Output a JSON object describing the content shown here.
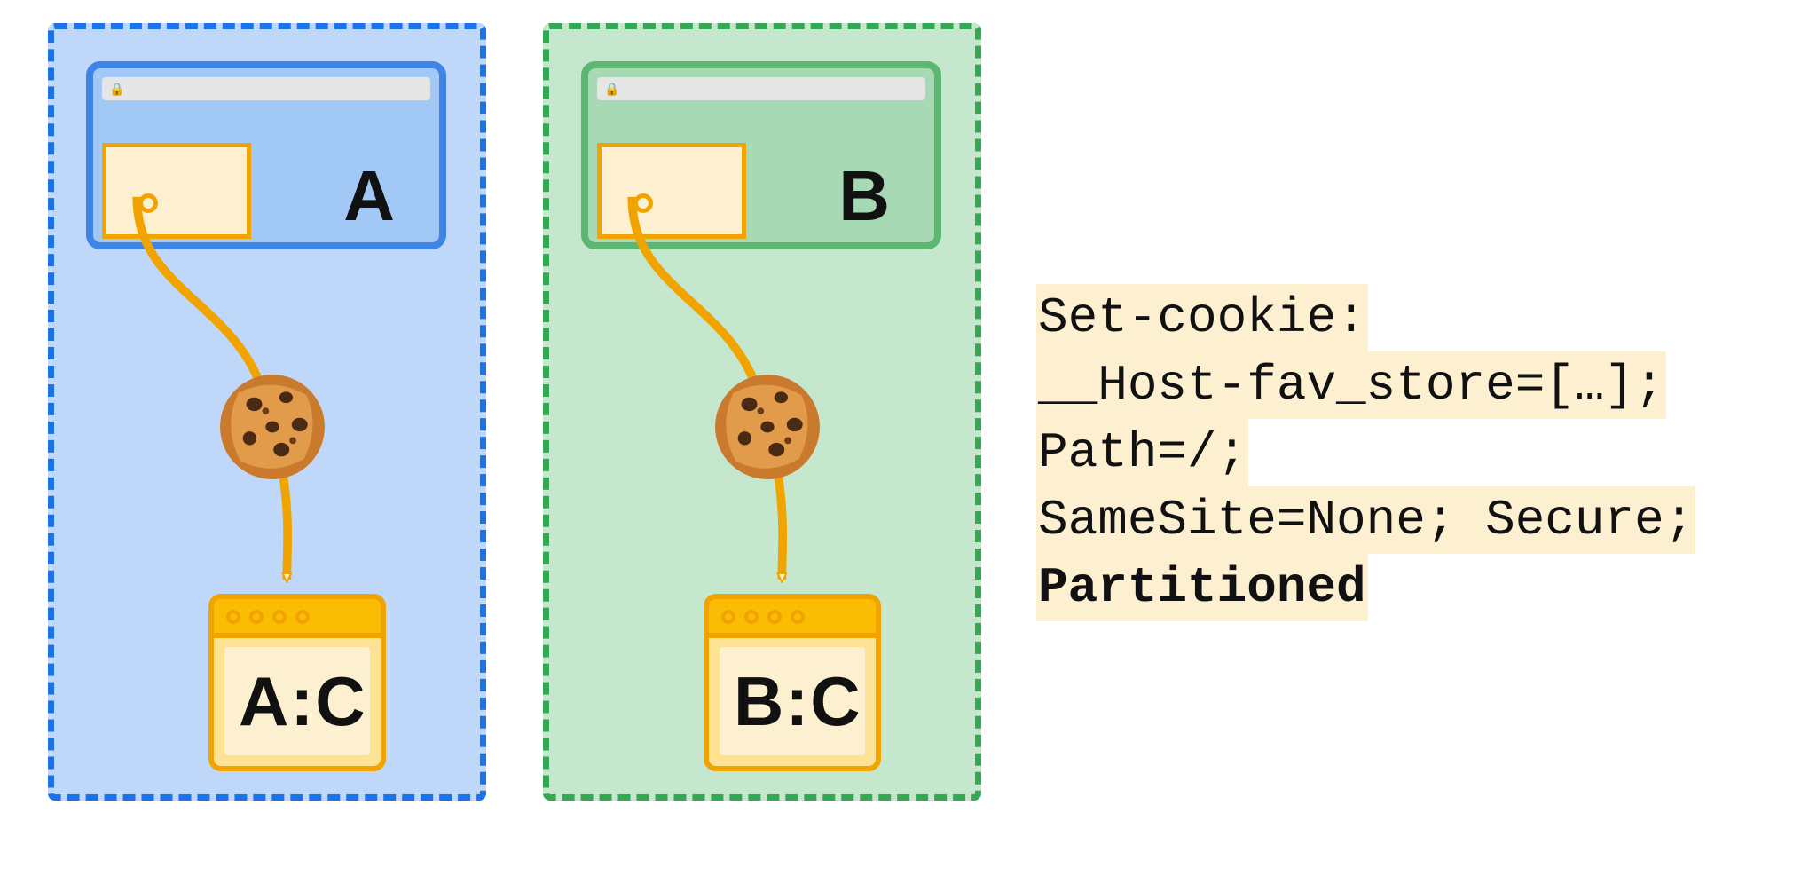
{
  "partitions": {
    "a": {
      "site_label": "A",
      "jar_label": "A:C"
    },
    "b": {
      "site_label": "B",
      "jar_label": "B:C"
    }
  },
  "cookie_icon": "🍪",
  "lock_icon": "🔒",
  "code": {
    "line1": "Set-cookie:",
    "line2": "__Host-fav_store=[…];",
    "line3": "Path=/;",
    "line4": "SameSite=None; Secure;",
    "line5": "Partitioned"
  },
  "colors": {
    "blue_border": "#1a73e8",
    "blue_fill": "#bfd8fa",
    "green_border": "#34a853",
    "green_fill": "#c5e7cd",
    "orange": "#f1a300",
    "orange_fill": "#fde293",
    "cream": "#fdf0d1"
  }
}
